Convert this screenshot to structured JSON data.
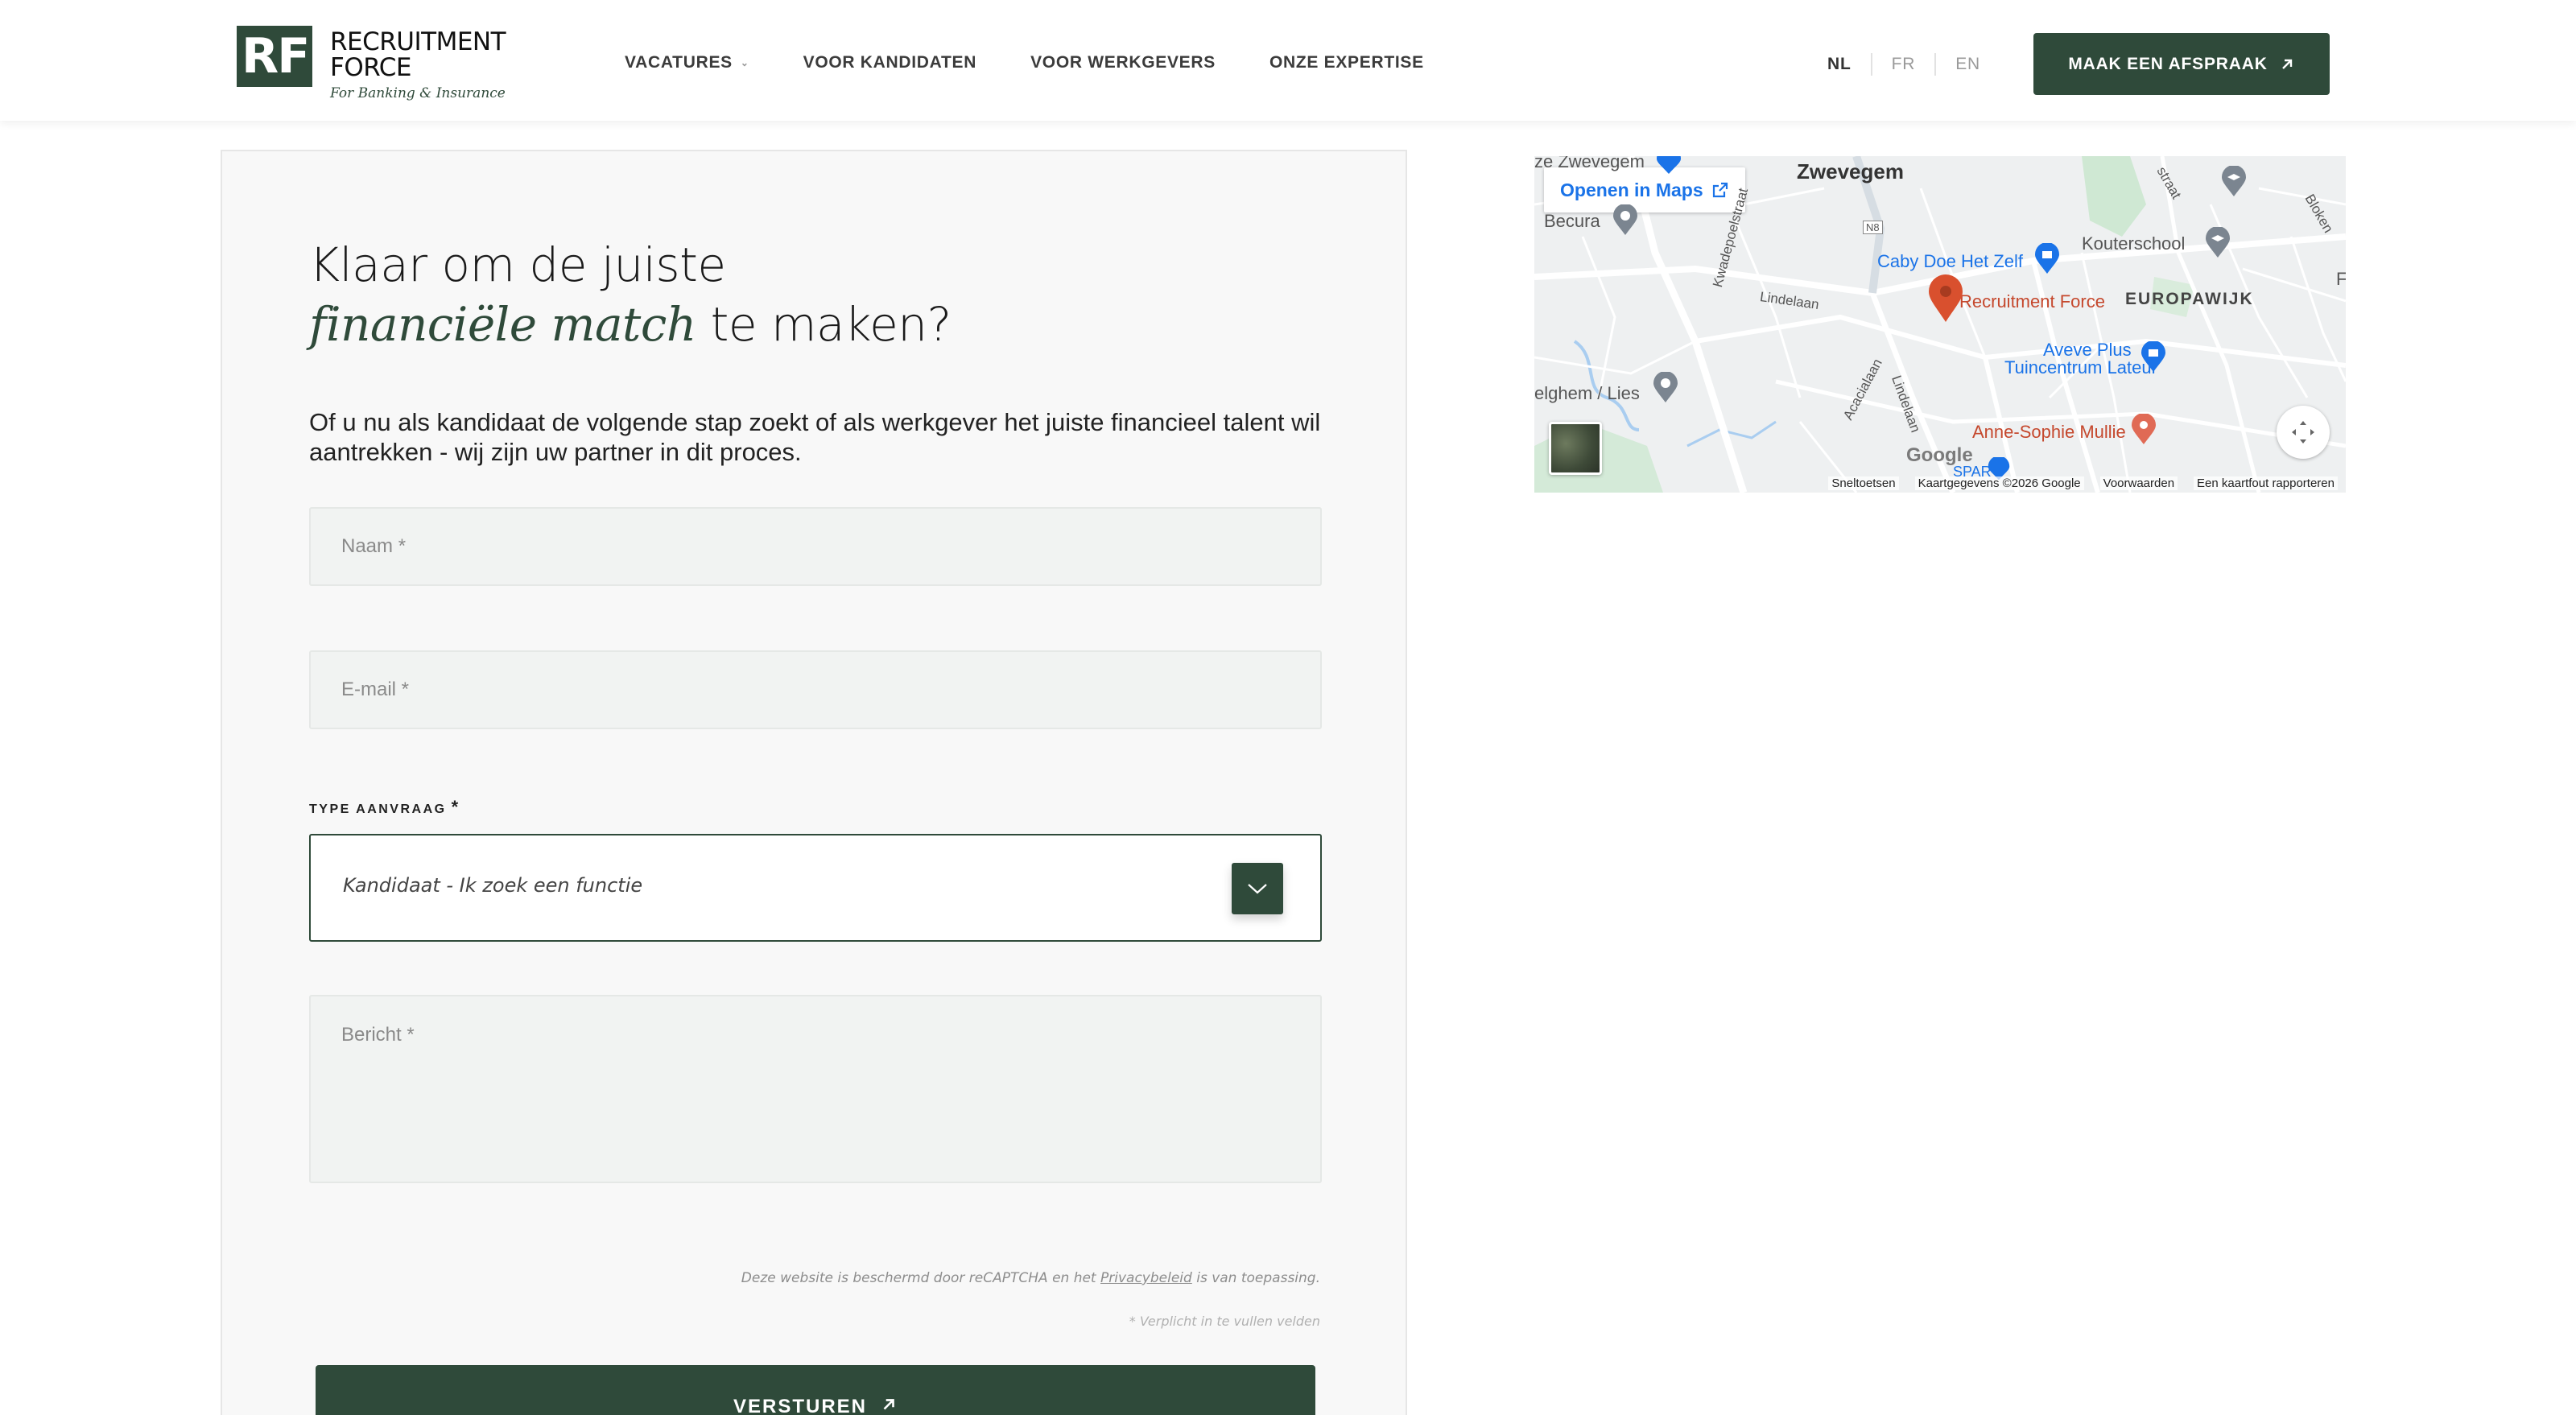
{
  "header": {
    "logo": {
      "mark": "RF",
      "name": "RECRUITMENT\nFORCE",
      "tagline": "For Banking & Insurance"
    },
    "nav": [
      {
        "label": "VACATURES",
        "has_dropdown": true
      },
      {
        "label": "VOOR KANDIDATEN"
      },
      {
        "label": "VOOR WERKGEVERS"
      },
      {
        "label": "ONZE EXPERTISE"
      }
    ],
    "languages": [
      {
        "label": "NL",
        "active": true
      },
      {
        "label": "FR"
      },
      {
        "label": "EN"
      }
    ],
    "cta_label": "MAAK EEN AFSPRAAK"
  },
  "form": {
    "headline_line1": "Klaar om de juiste",
    "headline_accent": "financiële match",
    "headline_rest": " te maken?",
    "lead": "Of u nu als kandidaat de volgende stap zoekt of als werkgever het juiste financieel talent wil aantrekken - wij zijn uw partner in dit proces.",
    "name_placeholder": "Naam *",
    "email_placeholder": "E-mail *",
    "type_label": "TYPE AANVRAAG",
    "type_required": "*",
    "type_value": "Kandidaat - Ik zoek een functie",
    "message_placeholder": "Bericht *",
    "legal_prefix": "Deze website is beschermd door reCAPTCHA en het ",
    "legal_link": "Privacybeleid",
    "legal_suffix": " is van toepassing.",
    "required_note": "* Verplicht in te vullen velden",
    "submit_label": "VERSTUREN"
  },
  "map": {
    "open_label": "Openen in Maps",
    "labels": {
      "zwevegem_top": "ze Zwevegem",
      "zwevegem": "Zwevegem",
      "becura": "Becura",
      "kwadepoelstraat": "Kwadepoelstraat",
      "n8": "N8",
      "caby": "Caby Doe Het Zelf",
      "kouterschool": "Kouterschool",
      "recruitment_force": "Recruitment Force",
      "europawijk": "EUROPAWIJK",
      "lindelaan": "Lindelaan",
      "lindelaan2": "Lindelaan",
      "acacialaan": "Acacialaan",
      "aveve1": "Aveve Plus",
      "aveve2": "Tuincentrum Lateur",
      "elghem": "elghem / Lies",
      "anne": "Anne-Sophie Mullie",
      "straat": "straat",
      "bloken": "Bloken",
      "f": "F",
      "spar": "SPAR"
    },
    "footer": [
      "Sneltoetsen",
      "Kaartgegevens ©2026 Google",
      "Voorwaarden",
      "Een kaartfout rapporteren"
    ],
    "google": "Google"
  },
  "colors": {
    "brand": "#2f4a3a",
    "map_link": "#1a73e8",
    "map_red": "#c5482d"
  }
}
